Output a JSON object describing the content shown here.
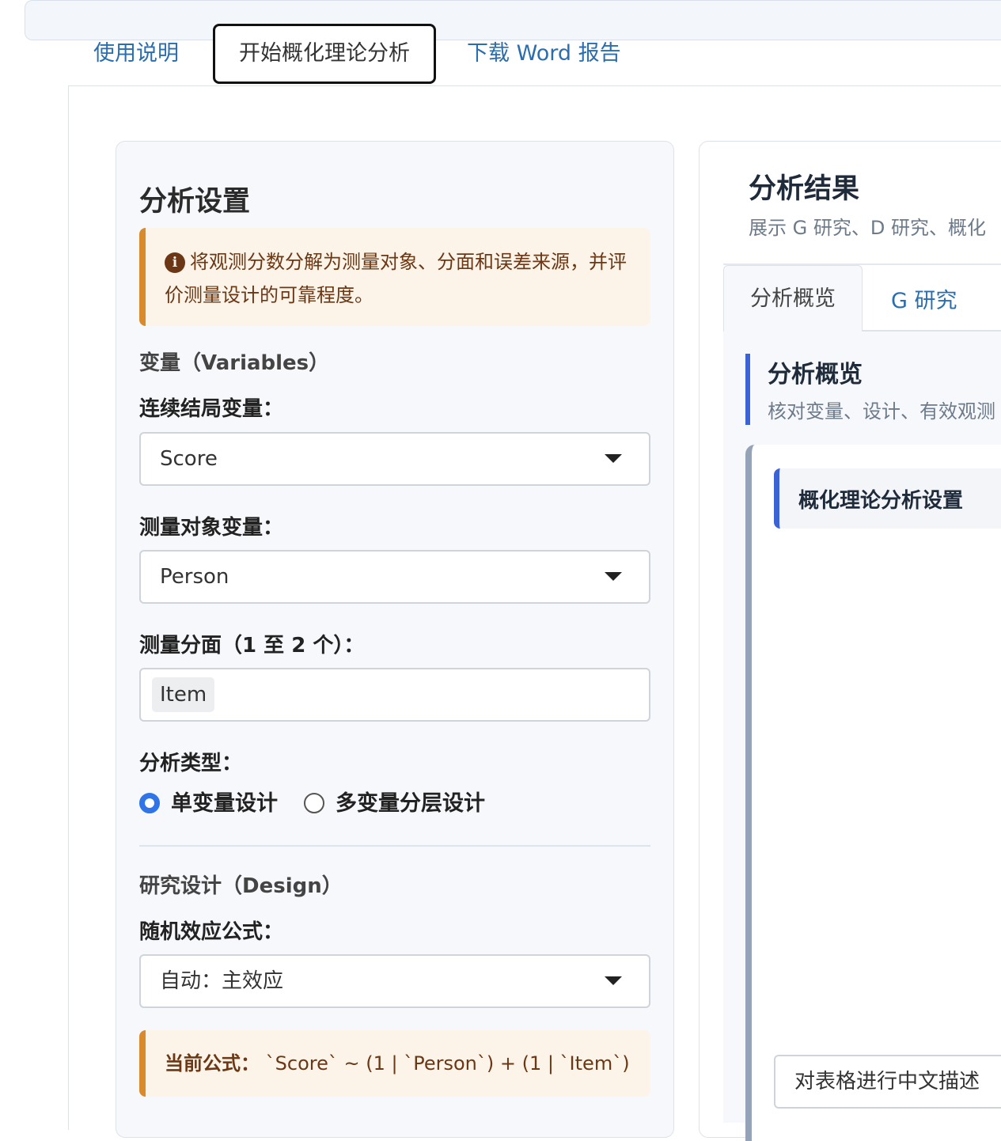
{
  "tabs": {
    "items": [
      {
        "label": "使用说明",
        "active": false
      },
      {
        "label": "开始概化理论分析",
        "active": true
      },
      {
        "label": "下载 Word 报告",
        "active": false
      }
    ]
  },
  "settings": {
    "title": "分析设置",
    "info_text": "将观测分数分解为测量对象、分面和误差来源，并评价测量设计的可靠程度。",
    "variables_section": "变量（Variables）",
    "outcome": {
      "label": "连续结局变量：",
      "value": "Score"
    },
    "object": {
      "label": "测量对象变量：",
      "value": "Person"
    },
    "facets": {
      "label": "测量分面（1 至 2 个）：",
      "chips": [
        "Item"
      ]
    },
    "analysis_type": {
      "label": "分析类型：",
      "options": [
        "单变量设计",
        "多变量分层设计"
      ],
      "selected": "单变量设计"
    },
    "design_section": "研究设计（Design）",
    "formula_select": {
      "label": "随机效应公式：",
      "value": "自动：主效应"
    },
    "current_formula": {
      "label": "当前公式：",
      "value": "`Score` ~ (1 | `Person`) + (1 | `Item`)"
    }
  },
  "results": {
    "title": "分析结果",
    "subtitle": "展示 G 研究、D 研究、概化",
    "tabs": [
      {
        "label": "分析概览",
        "active": true
      },
      {
        "label": "G 研究",
        "active": false
      }
    ],
    "overview": {
      "title": "分析概览",
      "subtitle": "核对变量、设计、有效观测"
    },
    "settings_box_title": "概化理论分析设置",
    "describe_button": "对表格进行中文描述"
  },
  "colors": {
    "link": "#2a6eb0",
    "accent_orange": "#d98a2b",
    "accent_blue": "#3b63d6",
    "radio_selected": "#2f74e8"
  }
}
